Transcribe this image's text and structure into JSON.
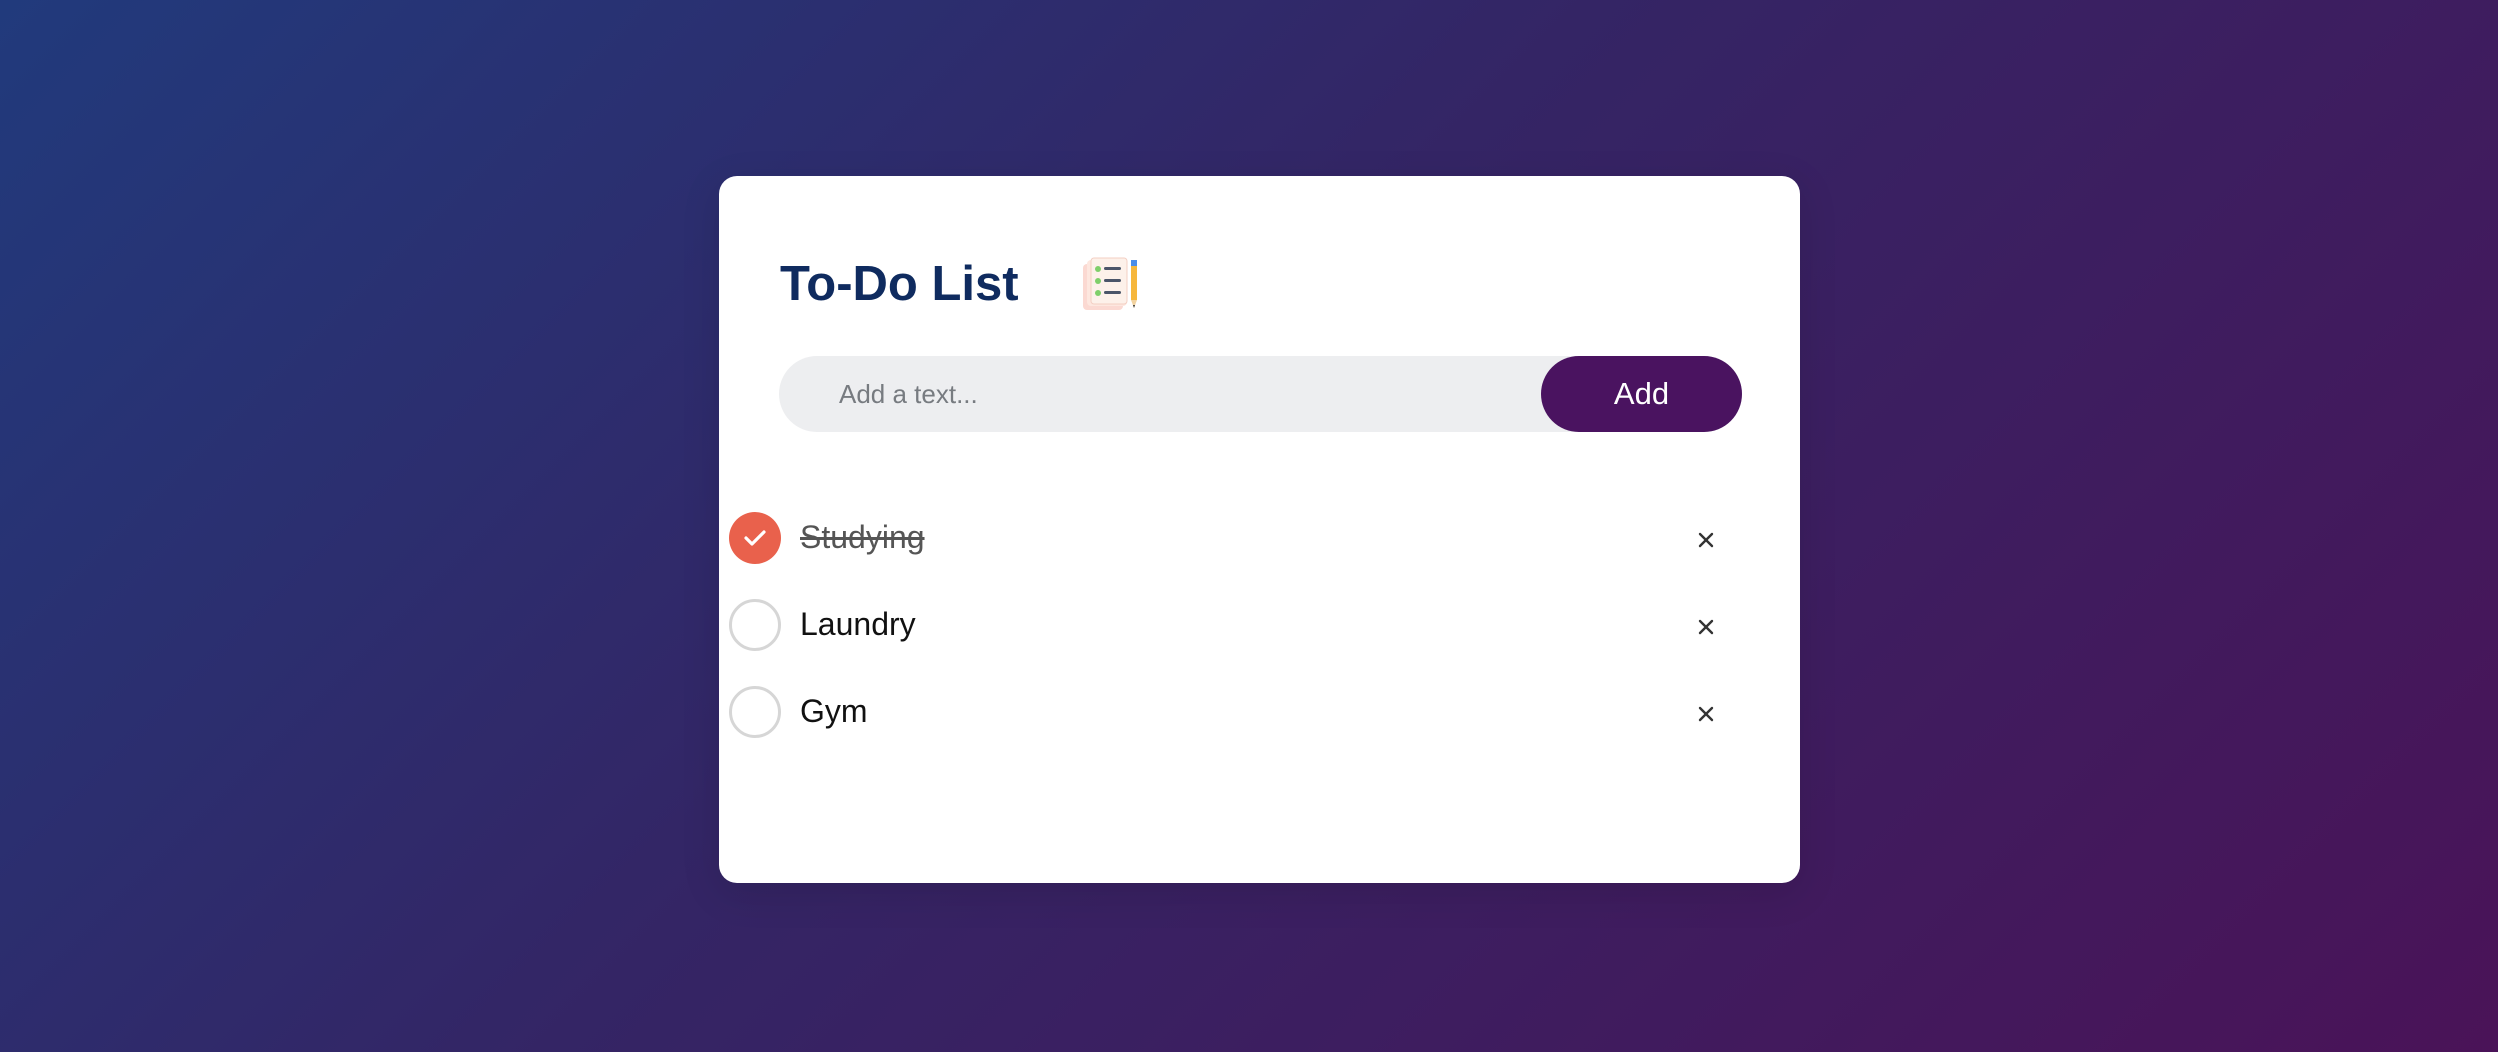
{
  "app": {
    "title": "To-Do List",
    "title_icon": "notepad-pencil-icon"
  },
  "input": {
    "placeholder": "Add a text...",
    "value": ""
  },
  "add_button": {
    "label": "Add"
  },
  "tasks": [
    {
      "text": "Studying",
      "checked": true
    },
    {
      "text": "Laundry",
      "checked": false
    },
    {
      "text": "Gym",
      "checked": false
    }
  ],
  "icons": {
    "check": "check-icon",
    "delete": "close-icon"
  },
  "colors": {
    "title": "#0f2b5f",
    "accent_button": "#4a1360",
    "checked": "#e9614c",
    "input_bg": "#edeef0"
  }
}
